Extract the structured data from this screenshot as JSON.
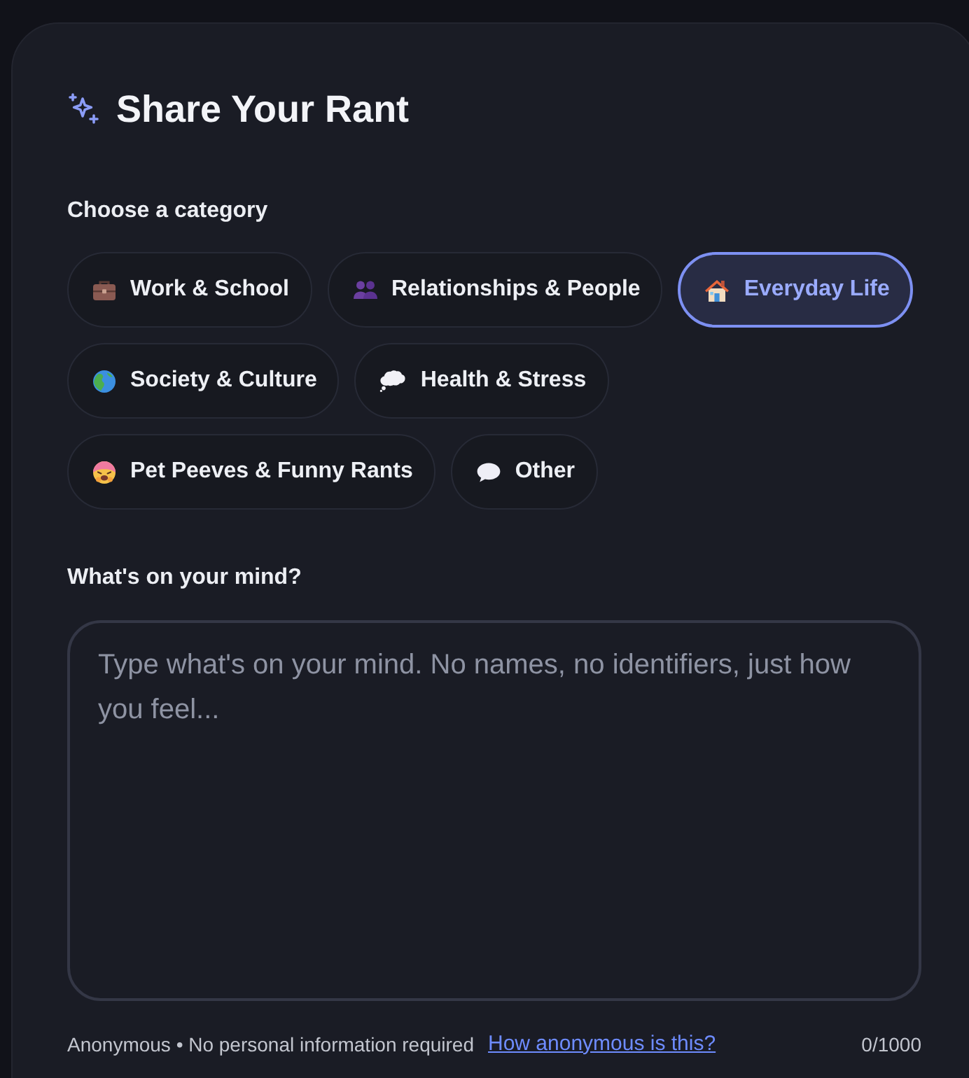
{
  "title": {
    "text": "Share Your Rant"
  },
  "category": {
    "label": "Choose a category",
    "options": [
      {
        "label": "Work & School",
        "selected": false
      },
      {
        "label": "Relationships & People",
        "selected": false
      },
      {
        "label": "Everyday Life",
        "selected": true
      },
      {
        "label": "Society & Culture",
        "selected": false
      },
      {
        "label": "Health & Stress",
        "selected": false
      },
      {
        "label": "Pet Peeves & Funny Rants",
        "selected": false
      },
      {
        "label": "Other",
        "selected": false
      }
    ]
  },
  "message": {
    "label": "What's on your mind?",
    "placeholder": "Type what's on your mind. No names, no identifiers, just how you feel..."
  },
  "footer": {
    "note": "Anonymous • No personal information required",
    "link": "How anonymous is this?",
    "counter": "0/1000"
  }
}
